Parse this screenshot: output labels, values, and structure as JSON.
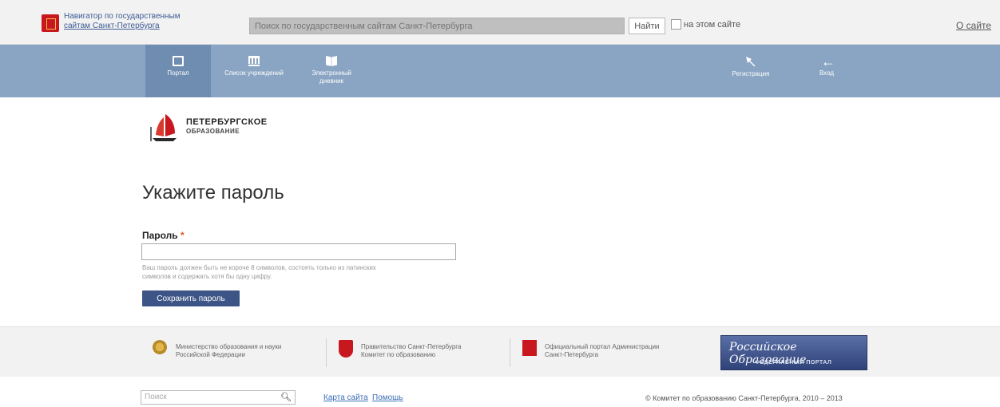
{
  "topbar": {
    "navigator_line1": "Навигатор по государственным",
    "navigator_line2": "сайтам Санкт-Петербурга",
    "search_placeholder": "Поиск по государственным сайтам Санкт-Петербурга",
    "find_label": "Найти",
    "site_only_label": "на этом сайте",
    "about_label": "О сайте"
  },
  "nav": {
    "portal": "Портал",
    "institutions": "Список учреждений",
    "diary_line1": "Электронный",
    "diary_line2": "дневник",
    "register": "Регистрация",
    "login": "Вход"
  },
  "logo": {
    "title": "ПЕТЕРБУРГСКОЕ",
    "subtitle": "ОБРАЗОВАНИЕ"
  },
  "form": {
    "title": "Укажите пароль",
    "password_label": "Пароль",
    "required_mark": "*",
    "password_value": "",
    "hint_line1": "Ваш пароль должен быть не короче 8 символов, состоять только из латинских",
    "hint_line2": "символов и содержать хотя бы одну цифру.",
    "save_label": "Сохранить пароль"
  },
  "partners": {
    "ministry_line1": "Министерство образования и науки",
    "ministry_line2": "Российской Федерации",
    "government_line1": "Правительство Санкт-Петербурга",
    "government_line2": "Комитет по образованию",
    "admin_line1": "Официальный портал Администрации",
    "admin_line2": "Санкт-Петербурга",
    "rus_edu_title": "Российское Образование",
    "rus_edu_sub": "ФЕДЕРАЛЬНЫЙ ПОРТАЛ"
  },
  "bottom": {
    "search_placeholder": "Поиск",
    "site_map": "Карта сайта",
    "help": "Помощь",
    "copyright": "© Комитет по образованию Санкт-Петербурга, 2010 – 2013"
  },
  "colors": {
    "nav_bg": "#8aa4c3",
    "nav_active": "#6f8cb1",
    "button_bg": "#3d5586",
    "emblem_red": "#c8171e"
  }
}
